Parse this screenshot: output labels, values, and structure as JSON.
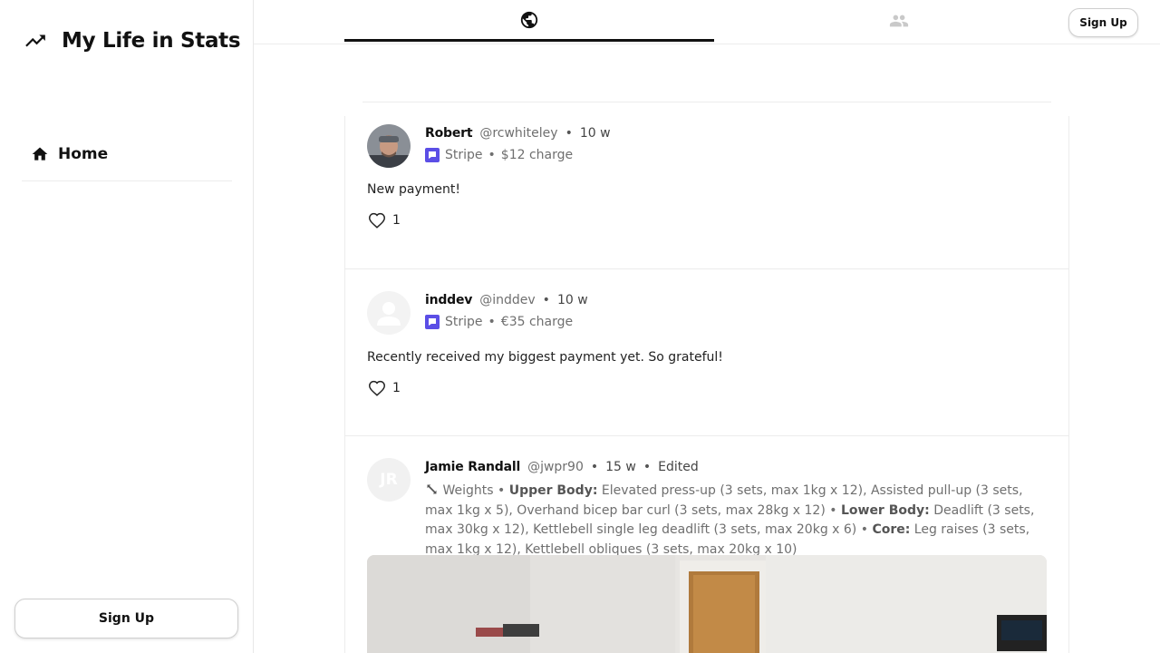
{
  "app": {
    "title": "My Life in Stats",
    "logo_icon": "trending-up-icon"
  },
  "sidebar": {
    "nav": [
      {
        "label": "Home",
        "icon": "home-icon"
      }
    ],
    "signup_label": "Sign Up"
  },
  "topbar": {
    "tabs": [
      {
        "name": "global",
        "icon": "globe-icon",
        "active": true
      },
      {
        "name": "friends",
        "icon": "people-icon",
        "active": false
      }
    ],
    "signup_label": "Sign Up"
  },
  "posts": [
    {
      "name": "Robert",
      "handle": "@rcwhiteley",
      "time": "10 w",
      "source": "Stripe",
      "detail": "$12 charge",
      "text": "New payment!",
      "likes": "1"
    },
    {
      "name": "inddev",
      "handle": "@inddev",
      "time": "10 w",
      "source": "Stripe",
      "detail": "€35 charge",
      "text": "Recently received my biggest payment yet. So grateful!",
      "likes": "1"
    },
    {
      "name": "Jamie Randall",
      "handle": "@jwpr90",
      "time": "15 w",
      "edited": "Edited",
      "initials": "JR",
      "source": "Weights",
      "sections": [
        {
          "title": "Upper Body:",
          "items": "Elevated press-up (3 sets, max 1kg x 12), Assisted pull-up (3 sets, max 1kg x 5), Overhand bicep bar curl (3 sets, max 28kg x 12)"
        },
        {
          "title": "Lower Body:",
          "items": "Deadlift (3 sets, max 30kg x 12), Kettlebell single leg deadlift (3 sets, max 20kg x 6)"
        },
        {
          "title": "Core:",
          "items": "Leg raises (3 sets, max 1kg x 12), Kettlebell obliques (3 sets, max 20kg x 10)"
        }
      ]
    }
  ],
  "separator": "•",
  "colors": {
    "accent": "#111111",
    "stripe": "#5b4ee6",
    "muted_text": "#6f6f6f",
    "border": "#ececec"
  }
}
